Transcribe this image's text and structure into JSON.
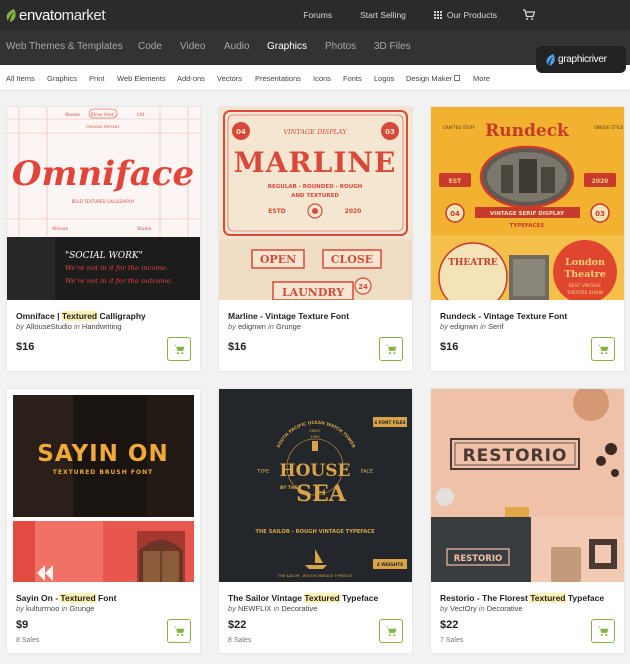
{
  "brand": {
    "name_part1": "envato",
    "name_part2": "market"
  },
  "top_links": {
    "forums": "Forums",
    "start_selling": "Start Selling",
    "our_products": "Our Products"
  },
  "categories": [
    "Web Themes & Templates",
    "Code",
    "Video",
    "Audio",
    "Graphics",
    "Photos",
    "3D Files"
  ],
  "active_category": "Graphics",
  "site_badge": "graphicriver",
  "subnav": [
    "All Items",
    "Graphics",
    "Print",
    "Web Elements",
    "Add-ons",
    "Vectors",
    "Presentations",
    "Icons",
    "Fonts",
    "Logos",
    "Design Maker",
    "More"
  ],
  "products": [
    {
      "title_pre": "Omniface | ",
      "title_hl": "Textured",
      "title_post": " Calligraphy",
      "by_word": "by",
      "author": "AllouseStudio",
      "in_word": "in",
      "category": "Handwriting",
      "price": "$16",
      "sales": "",
      "thumb": {
        "main": "Omniface",
        "top_left": "Alouse",
        "top_mid": "Now hnd.",
        "top_right": "Ltd.",
        "line1": "PROUDLY PRESENT",
        "sub": "BOLD TEXTURED CALLIGRAPHY",
        "corner_left": "Allouse",
        "corner_right": "Studio",
        "quote": "\"SOCIAL WORK\"",
        "l1": "We're not in it for the income.",
        "l2": "We're not in it for the outcome."
      }
    },
    {
      "title_pre": "Marline - Vintage Texture Font",
      "title_hl": "",
      "title_post": "",
      "by_word": "by",
      "author": "edignwn",
      "in_word": "in",
      "category": "Grunge",
      "price": "$16",
      "sales": "",
      "thumb": {
        "top": "VINTAGE DISPLAY",
        "main": "MARLINE",
        "sub1": "REGULAR - ROUNDED - ROUGH",
        "sub2": "AND TEXTURED",
        "estd": "ESTD",
        "year": "2020",
        "n1": "04",
        "n2": "03",
        "w1": "OPEN",
        "w2": "CLOSE",
        "w3": "LAUNDRY",
        "n3": "24"
      }
    },
    {
      "title_pre": "Rundeck - Vintage Texture Font",
      "title_hl": "",
      "title_post": "",
      "by_word": "by",
      "author": "edignwn",
      "in_word": "in",
      "category": "Serif",
      "price": "$16",
      "sales": "",
      "thumb": {
        "main": "Rundeck",
        "tl": "CRAFTED STUFF",
        "tr": "UNIQUE STYLE",
        "est": "EST",
        "year": "2020",
        "n1": "04",
        "n2": "03",
        "banner1": "VINTAGE SERIF DISPLAY",
        "banner2": "TYPEFACES",
        "theatre": "THEATRE",
        "london": "London",
        "theatre2": "Theatre",
        "show1": "BEST VINTAGE",
        "show2": "THEATRE SHOW"
      }
    },
    {
      "title_pre": "Sayin On - ",
      "title_hl": "Textured",
      "title_post": " Font",
      "by_word": "by",
      "author": "kulturrnoo",
      "in_word": "in",
      "category": "Grunge",
      "price": "$9",
      "sales": "8 Sales",
      "thumb": {
        "main": "SAYIN ON",
        "sub": "TEXTURED BRUSH FONT"
      }
    },
    {
      "title_pre": "The Sailor Vintage ",
      "title_hl": "Textured",
      "title_post": " Typeface",
      "by_word": "by",
      "author": "NEWFLIX",
      "in_word": "in",
      "category": "Decorative",
      "price": "$22",
      "sales": "8 Sales",
      "thumb": {
        "arc": "SOUTH PACIFIC OCEAN WATCH TOWER",
        "since": "SINCE",
        "year": "1995",
        "l1": "HOUSE",
        "by": "BY THE",
        "l2": "SEA",
        "type": "TYPE",
        "face": "FACE",
        "files": "4 FONT FILES",
        "tagline": "THE SAILOR - ROUGH VINTAGE TYPEFACE",
        "footer": "THE SAILOR - ROUGH VINTAGE TYPEFACE",
        "weights": "4 WEIGHTS"
      }
    },
    {
      "title_pre": "Restorio - The Florest ",
      "title_hl": "Textured",
      "title_post": " Typeface",
      "by_word": "by",
      "author": "VectOry",
      "in_word": "in",
      "category": "Decorative",
      "price": "$22",
      "sales": "7 Sales",
      "thumb": {
        "main": "RESTORIO",
        "small": "RESTORIO"
      }
    }
  ],
  "colors": {
    "topbar": "#2b2b2b",
    "catnav": "#333333",
    "accent_green": "#82b541",
    "highlight": "#fff1b2",
    "omniface_red": "#e2443a",
    "marline_red": "#d8493a",
    "rundeck_yellow": "#f2b12e",
    "sayin_gold": "#f0a83a",
    "sailor_bg": "#23262a",
    "restorio_bg": "#e9b79e"
  },
  "icons": {
    "logo": "leaf-icon",
    "products": "grid-icon",
    "cart": "cart-icon",
    "external": "external-link-icon"
  }
}
